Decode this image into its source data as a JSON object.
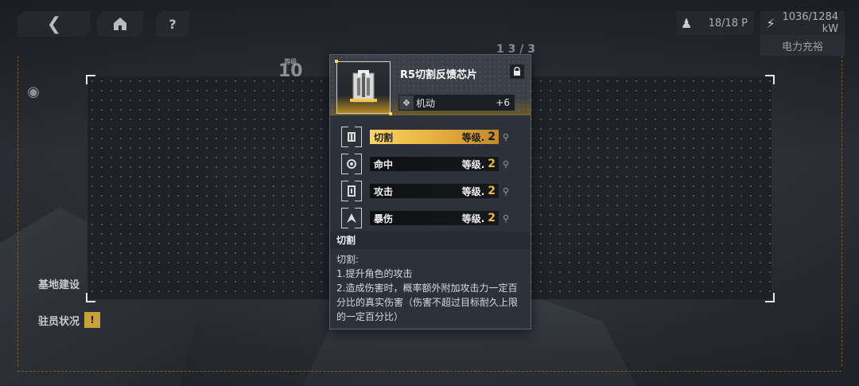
{
  "topbar": {
    "back_icon": "back-chevron-icon",
    "home_icon": "home-icon",
    "help_icon": "question-icon",
    "population": "18/18 P",
    "power": "1036/1284 kW",
    "charge_label": "电力充裕"
  },
  "side": {
    "base_label": "基地建设",
    "staff_label": "驻员状况"
  },
  "level_tag": {
    "caption": "等级",
    "value": "10"
  },
  "counter_tag": "1 3 / 3",
  "chip": {
    "title": "R5切割反馈芯片",
    "stat": {
      "name": "机动",
      "value": "+6"
    },
    "skills": [
      {
        "name": "切割",
        "level_label": "等级.",
        "level": "2",
        "active": true
      },
      {
        "name": "命中",
        "level_label": "等级.",
        "level": "2",
        "active": false
      },
      {
        "name": "攻击",
        "level_label": "等级.",
        "level": "2",
        "active": false
      },
      {
        "name": "暴伤",
        "level_label": "等级.",
        "level": "2",
        "active": false
      }
    ],
    "desc_title": "切割",
    "desc_lines": [
      "切割:",
      "1.提升角色的攻击",
      "2.造成伤害时，概率额外附加攻击力一定百分比的真实伤害（伤害不超过目标耐久上限的一定百分比）"
    ]
  },
  "colors": {
    "accent": "#ffd561",
    "panel": "#2c313a"
  }
}
